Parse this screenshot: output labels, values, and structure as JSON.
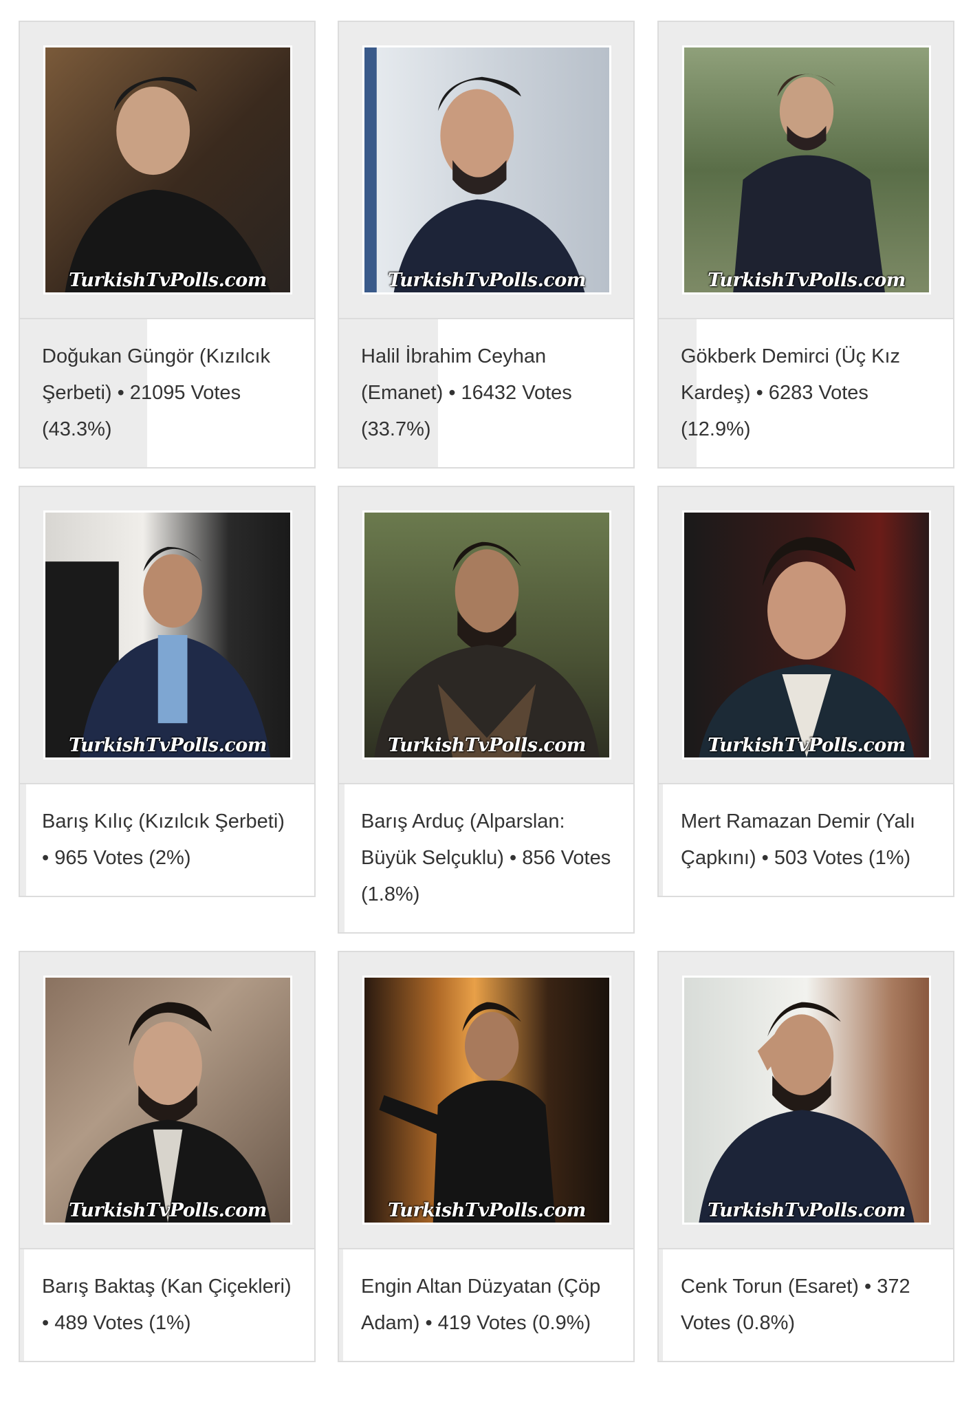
{
  "watermark": "TurkishTvPolls.com",
  "candidates": [
    {
      "name_line": "Doğukan Güngör (Kızılcık Şerbeti) • 21095 Votes (43.3%)",
      "percent": 43.3
    },
    {
      "name_line": "Halil İbrahim Ceyhan (Emanet) • 16432 Votes (33.7%)",
      "percent": 33.7
    },
    {
      "name_line": "Gökberk Demirci (Üç Kız Kardeş) • 6283 Votes (12.9%)",
      "percent": 12.9
    },
    {
      "name_line": "Barış Kılıç (Kızılcık Şerbeti) • 965 Votes (2%)",
      "percent": 2
    },
    {
      "name_line": "Barış Arduç (Alparslan: Büyük Selçuklu) • 856 Votes (1.8%)",
      "percent": 1.8
    },
    {
      "name_line": "Mert Ramazan Demir (Yalı Çapkını) • 503 Votes (1%)",
      "percent": 1
    },
    {
      "name_line": "Barış Baktaş (Kan Çiçekleri) • 489 Votes (1%)",
      "percent": 1
    },
    {
      "name_line": "Engin Altan Düzyatan (Çöp Adam) • 419 Votes (0.9%)",
      "percent": 0.9
    },
    {
      "name_line": "Cenk Torun (Esaret) • 372 Votes (0.8%)",
      "percent": 0.8
    }
  ]
}
